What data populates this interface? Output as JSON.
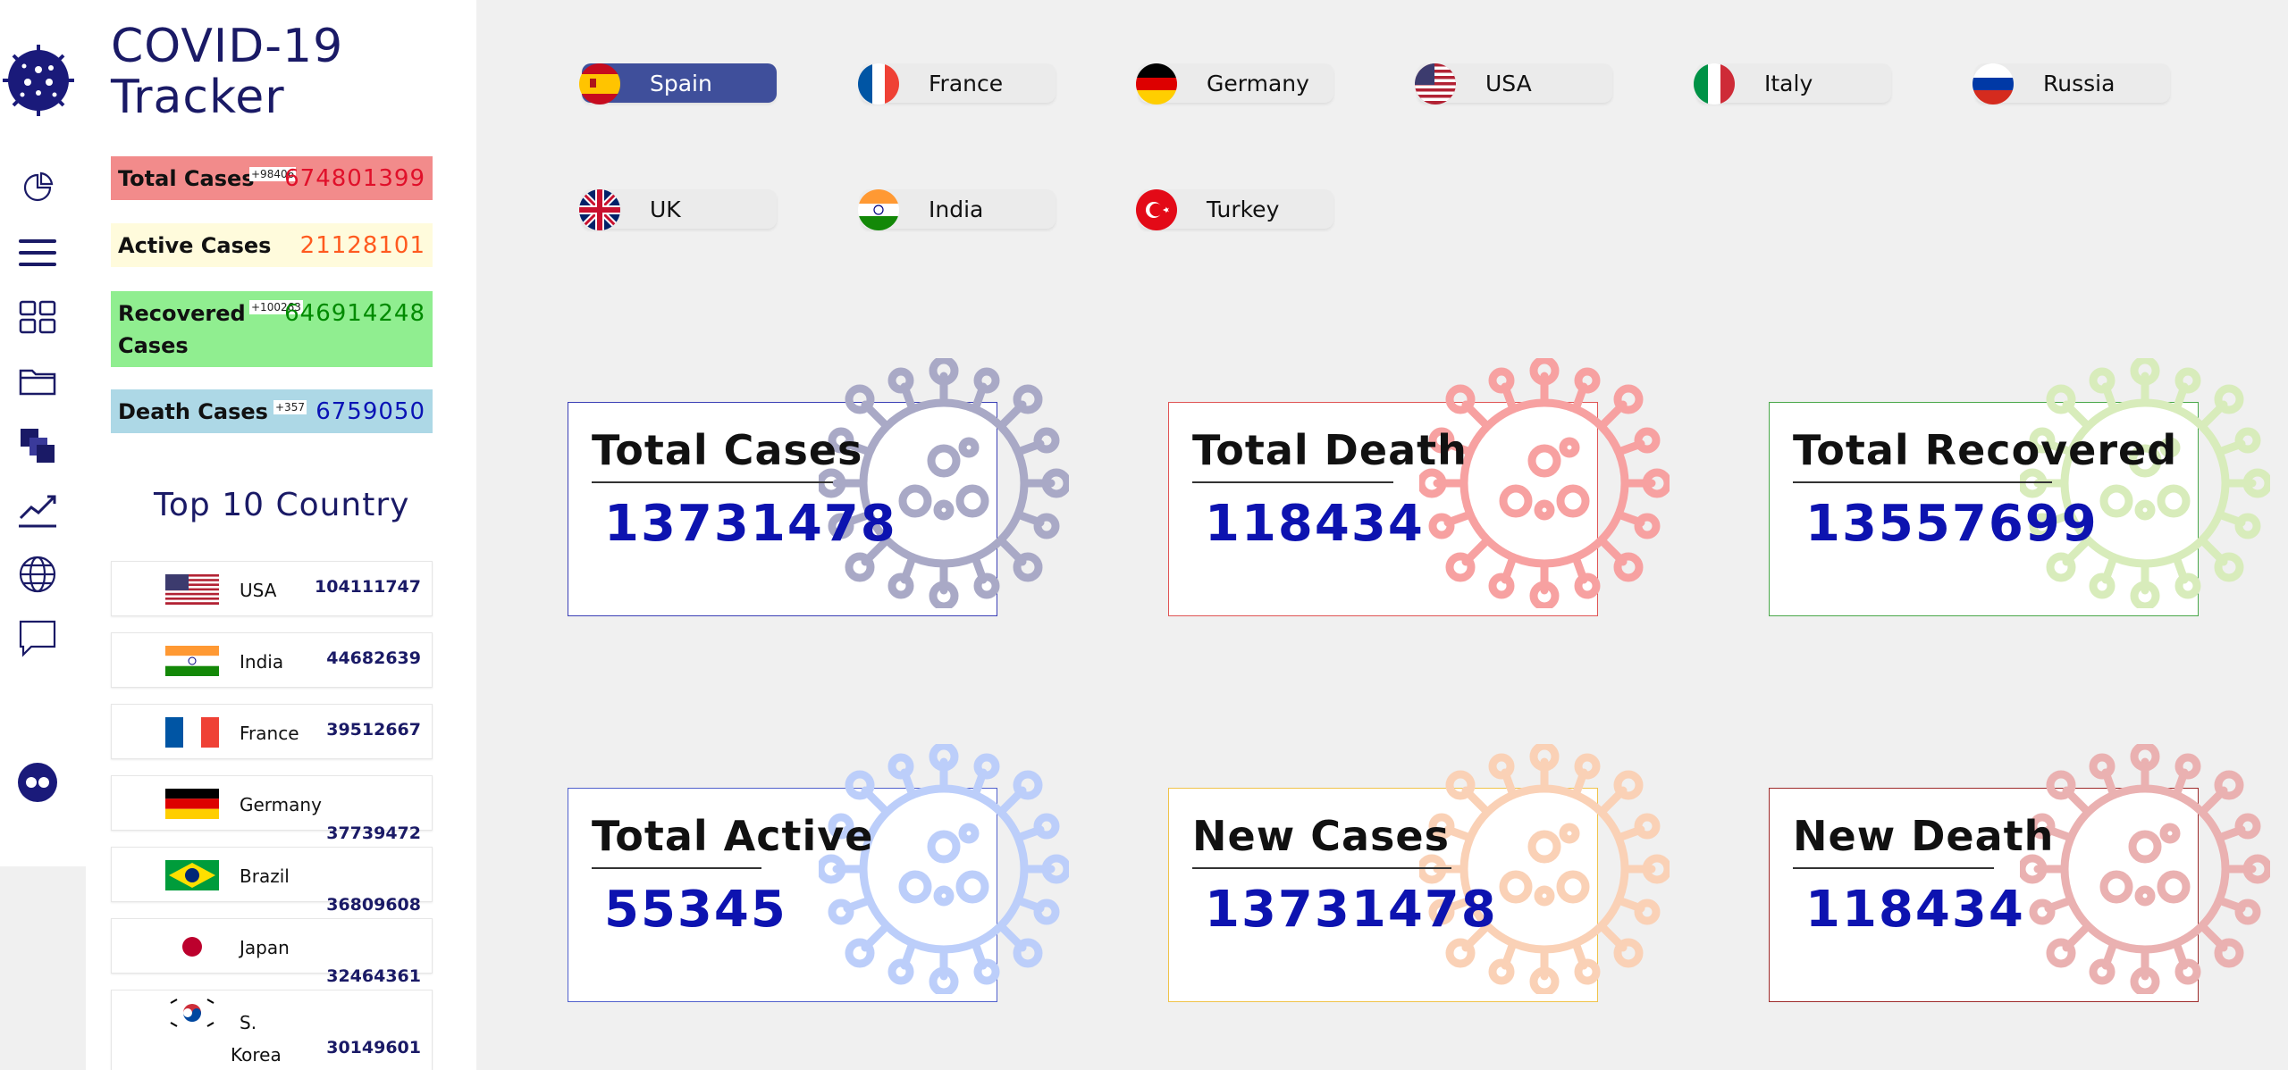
{
  "app": {
    "title_line1": "COVID-19",
    "title_line2": "Tracker"
  },
  "colors": {
    "brand": "#1a1a66",
    "total_cases_bg": "#f28b8b",
    "active_cases_bg": "#fffbdc",
    "recovered_bg": "#90ee90",
    "death_bg": "#add8e6",
    "active_country_btn": "#3f4f9b",
    "card_value": "#0d13b0"
  },
  "nav": {
    "items": [
      "pie-chart-icon",
      "menu-icon",
      "grid-icon",
      "folder-icon",
      "layers-icon",
      "trend-icon",
      "globe-icon",
      "chat-icon"
    ],
    "bottom": "flickr-icon"
  },
  "stats": {
    "total": {
      "label": "Total Cases",
      "delta": "+98406",
      "value": "674801399",
      "value_color": "#e0102a"
    },
    "active": {
      "label": "Active Cases",
      "value": "21128101",
      "value_color": "#ff5a1f"
    },
    "recovered": {
      "label_line1": "Recovered",
      "label_line2": "Cases",
      "delta": "+100263",
      "value": "646914248",
      "value_color": "#008a00"
    },
    "death": {
      "label": "Death Cases",
      "delta": "+357",
      "value": "6759050",
      "value_color": "#0a13b5"
    }
  },
  "top10": {
    "title": "Top 10 Country",
    "rows": [
      {
        "name": "USA",
        "value": "104111747",
        "flag": "usa-flag"
      },
      {
        "name": "India",
        "value": "44682639",
        "flag": "india-flag"
      },
      {
        "name": "France",
        "value": "39512667",
        "flag": "france-flag"
      },
      {
        "name": "Germany",
        "value": "37739472",
        "flag": "germany-flag"
      },
      {
        "name": "Brazil",
        "value": "36809608",
        "flag": "brazil-flag"
      },
      {
        "name": "Japan",
        "value": "32464361",
        "flag": "japan-flag"
      },
      {
        "name_line1": "S.",
        "name_line2": "Korea",
        "value": "30149601",
        "flag": "south-korea-flag"
      }
    ]
  },
  "countries": [
    {
      "label": "Spain",
      "active": true
    },
    {
      "label": "France",
      "active": false
    },
    {
      "label": "Germany",
      "active": false
    },
    {
      "label": "USA",
      "active": false
    },
    {
      "label": "Italy",
      "active": false
    },
    {
      "label": "Russia",
      "active": false
    },
    {
      "label": "UK",
      "active": false
    },
    {
      "label": "India",
      "active": false
    },
    {
      "label": "Turkey",
      "active": false
    }
  ],
  "cards": [
    {
      "title": "Total Cases",
      "value": "13731478",
      "border": "#3a3fb5",
      "virus_color": "#a9a9c6"
    },
    {
      "title": "Total Death",
      "value": "118434",
      "border": "#e05555",
      "virus_color": "#f7a1a1"
    },
    {
      "title": "Total Recovered",
      "value": "13557699",
      "border": "#4aa84a",
      "virus_color": "#d8ecbb"
    },
    {
      "title": "Total Active",
      "value": "55345",
      "border": "#5060cc",
      "virus_color": "#bccefa"
    },
    {
      "title": "New Cases",
      "value": "13731478",
      "border": "#f0c34a",
      "virus_color": "#fad1b6"
    },
    {
      "title": "New Death",
      "value": "118434",
      "border": "#9e2b2b",
      "virus_color": "#eab1b1"
    }
  ]
}
